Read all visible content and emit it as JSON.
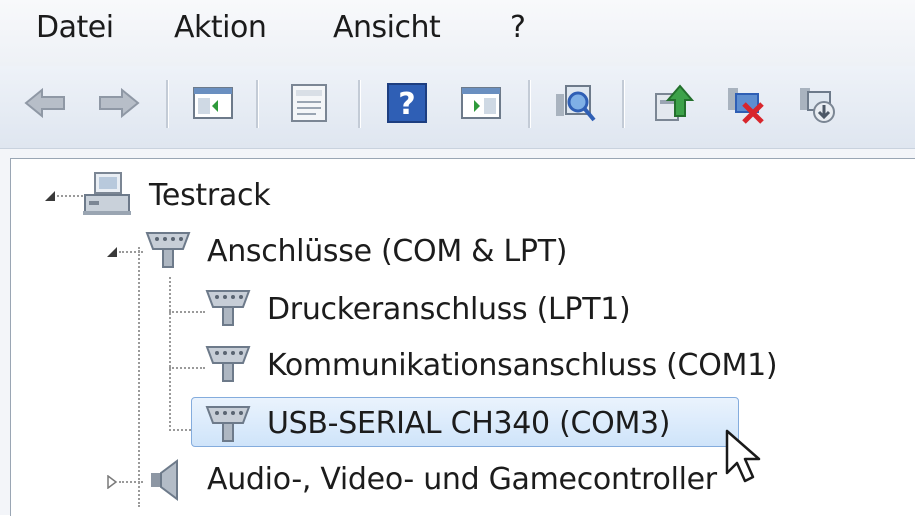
{
  "menu": {
    "items": [
      "Datei",
      "Aktion",
      "Ansicht",
      "?"
    ]
  },
  "toolbar": {
    "buttons": [
      "back-arrow-icon",
      "forward-arrow-icon",
      "show-hide-console-tree-icon",
      "properties-icon",
      "help-icon",
      "show-hide-action-pane-icon",
      "scan-hardware-icon",
      "update-driver-icon",
      "uninstall-device-icon",
      "disable-device-icon"
    ]
  },
  "tree": {
    "root": "Testrack",
    "category_ports": "Anschlüsse (COM & LPT)",
    "items": [
      "Druckeranschluss (LPT1)",
      "Kommunikationsanschluss (COM1)",
      "USB-SERIAL CH340 (COM3)"
    ],
    "category_audio": "Audio-, Video- und Gamecontroller"
  },
  "colors": {
    "selection_fill": "#cfe4fa",
    "selection_border": "#84acdd"
  }
}
